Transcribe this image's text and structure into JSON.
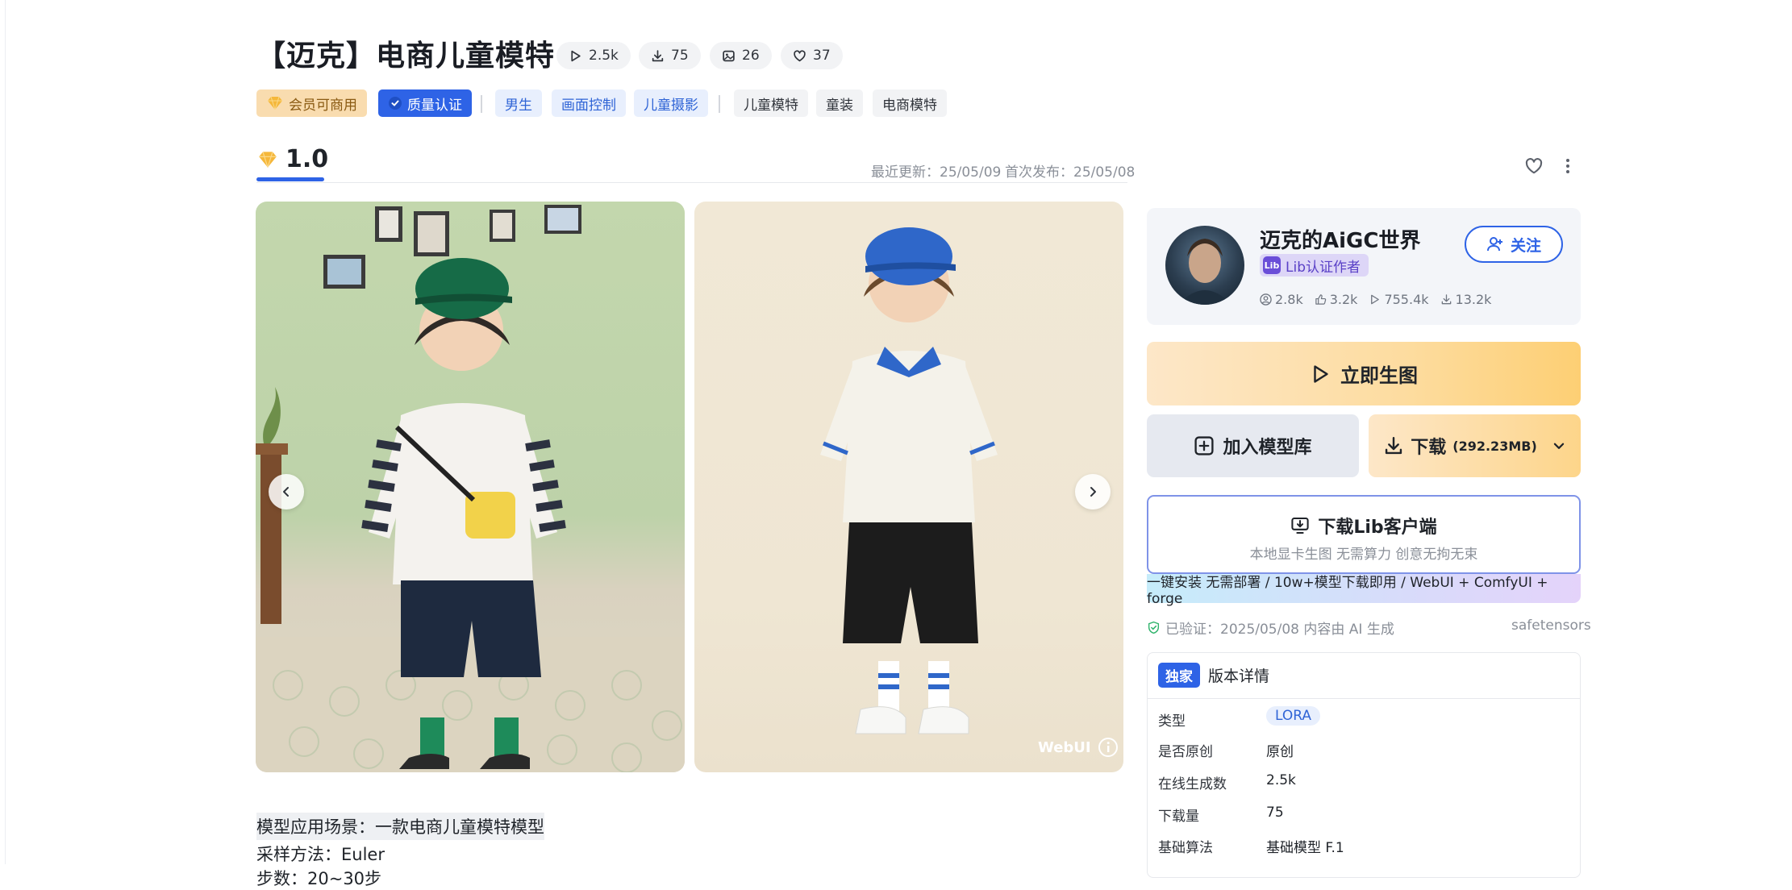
{
  "model": {
    "title": "【迈克】电商儿童模特",
    "stats": [
      {
        "icon": "play-icon",
        "value": "2.5k"
      },
      {
        "icon": "download-icon",
        "value": "75"
      },
      {
        "icon": "image-icon",
        "value": "26"
      },
      {
        "icon": "heart-icon",
        "value": "37"
      }
    ]
  },
  "tags": {
    "member": "会员可商用",
    "quality": "质量认证",
    "blue": [
      "男生",
      "画面控制",
      "儿童摄影"
    ],
    "gray": [
      "儿童模特",
      "童装",
      "电商模特"
    ]
  },
  "version": {
    "label": "1.0",
    "updated": "最近更新：25/05/09",
    "published": "首次发布：25/05/08"
  },
  "gallery": {
    "watermark": "WebUI"
  },
  "description": {
    "line1": "模型应用场景：一款电商儿童模特模型",
    "line2": "采样方法：Euler",
    "line3": "步数：20~30步"
  },
  "author": {
    "name": "迈克的AiGC世界",
    "badge_logo": "Lib",
    "badge": "Lib认证作者",
    "follow": "关注",
    "stats": [
      {
        "icon": "user-icon",
        "value": "2.8k"
      },
      {
        "icon": "like-icon",
        "value": "3.2k"
      },
      {
        "icon": "play-icon",
        "value": "755.4k"
      },
      {
        "icon": "download-icon",
        "value": "13.2k"
      }
    ]
  },
  "actions": {
    "generate": "立即生图",
    "add_library": "加入模型库",
    "download": "下载",
    "download_size": "(292.23MB)"
  },
  "client": {
    "title": "下载Lib客户端",
    "subtitle": "本地显卡生图 无需算力 创意无拘无束",
    "strip": "一键安装 无需部署 / 10w+模型下载即用 / WebUI + ComfyUI + forge"
  },
  "verification": {
    "text": "已验证：2025/05/08 内容由 AI 生成",
    "format": "safetensors"
  },
  "details": {
    "exclusive": "独家",
    "heading": "版本详情",
    "rows": [
      {
        "key": "类型",
        "value": "LORA"
      },
      {
        "key": "是否原创",
        "value": "原创"
      },
      {
        "key": "在线生成数",
        "value": "2.5k"
      },
      {
        "key": "下载量",
        "value": "75"
      },
      {
        "key": "基础算法",
        "value": "基础模型 F.1"
      }
    ]
  },
  "colors": {
    "accent": "#2e63e6",
    "gold": "#fdcf74",
    "lib_purple": "#6a4ed8"
  }
}
